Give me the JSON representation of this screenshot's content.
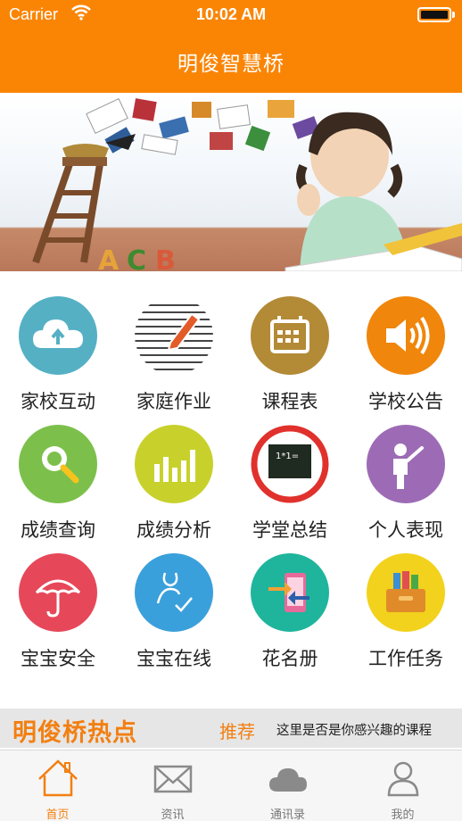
{
  "status_bar": {
    "carrier": "Carrier",
    "time": "10:02 AM"
  },
  "header": {
    "title": "明俊智慧桥"
  },
  "colors": {
    "brand_orange": "#fa8505",
    "accent_text": "#f27f11"
  },
  "grid": [
    {
      "label": "家校互动",
      "icon": "cloud-upload-icon",
      "color": "#55b0c4"
    },
    {
      "label": "家庭作业",
      "icon": "pencil-lines-icon",
      "color": "#ffffff"
    },
    {
      "label": "课程表",
      "icon": "calendar-icon",
      "color": "#b38a36"
    },
    {
      "label": "学校公告",
      "icon": "speaker-icon",
      "color": "#f0860b"
    },
    {
      "label": "成绩查询",
      "icon": "magnifier-icon",
      "color": "#7cc04b"
    },
    {
      "label": "成绩分析",
      "icon": "bar-chart-icon",
      "color": "#c8d12b"
    },
    {
      "label": "学堂总结",
      "icon": "blackboard-icon",
      "color": "#ffffff",
      "board_text": "1*1="
    },
    {
      "label": "个人表现",
      "icon": "student-icon",
      "color": "#9d6bb5"
    },
    {
      "label": "宝宝安全",
      "icon": "umbrella-icon",
      "color": "#e6485a"
    },
    {
      "label": "宝宝在线",
      "icon": "person-check-icon",
      "color": "#3aa0db"
    },
    {
      "label": "花名册",
      "icon": "phone-transfer-icon",
      "color": "#1fb59d"
    },
    {
      "label": "工作任务",
      "icon": "folder-box-icon",
      "color": "#f2d21c"
    }
  ],
  "hot": {
    "title": "明俊桥热点",
    "recommend": "推荐",
    "ticker": "这里是否是你感兴趣的课程"
  },
  "tabs": [
    {
      "label": "首页",
      "icon": "home-icon",
      "active": true
    },
    {
      "label": "资讯",
      "icon": "mail-icon",
      "active": false
    },
    {
      "label": "通讯录",
      "icon": "cloud-icon",
      "active": false
    },
    {
      "label": "我的",
      "icon": "user-icon",
      "active": false
    }
  ]
}
